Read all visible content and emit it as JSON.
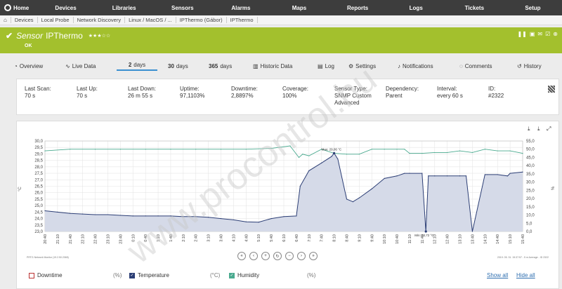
{
  "topnav": {
    "home": "Home",
    "items": [
      "Devices",
      "Libraries",
      "Sensors",
      "Alarms",
      "Maps",
      "Reports",
      "Logs",
      "Tickets",
      "Setup"
    ]
  },
  "breadcrumbs": [
    "Devices",
    "Local Probe",
    "Network Discovery",
    "Linux / MacOS / ...",
    "IPThermo (Gábor)",
    "IPThermo"
  ],
  "sensor": {
    "kind": "Sensor",
    "name": "IPThermo",
    "stars": "★★★☆☆",
    "status": "OK",
    "bar_color": "#a3c02d"
  },
  "tabs": [
    {
      "icon": "◔",
      "label": "Overview"
    },
    {
      "icon": "∿",
      "label": "Live Data"
    },
    {
      "num": "2",
      "label": "days",
      "active": true
    },
    {
      "num": "30",
      "label": "days"
    },
    {
      "num": "365",
      "label": "days"
    },
    {
      "icon": "▥",
      "label": "Historic Data"
    },
    {
      "icon": "▤",
      "label": "Log"
    },
    {
      "icon": "⚙",
      "label": "Settings"
    },
    {
      "icon": "🔔",
      "label": "Notifications"
    },
    {
      "icon": "◌",
      "label": "Comments"
    },
    {
      "icon": "↺",
      "label": "History"
    }
  ],
  "info": {
    "last_scan": {
      "label": "Last Scan:",
      "value": "70 s"
    },
    "last_up": {
      "label": "Last Up:",
      "value": "70 s"
    },
    "last_down": {
      "label": "Last Down:",
      "value": "26 m 55 s"
    },
    "uptime": {
      "label": "Uptime:",
      "value": "97,1103%"
    },
    "downtime": {
      "label": "Downtime:",
      "value": "2,8897%"
    },
    "coverage": {
      "label": "Coverage:",
      "value": "100%"
    },
    "sensor_type": {
      "label": "Sensor Type:",
      "value": "SNMP Custom",
      "value2": "Advanced"
    },
    "dependency": {
      "label": "Dependency:",
      "value": "Parent"
    },
    "interval": {
      "label": "Interval:",
      "value": "every 60 s"
    },
    "id": {
      "label": "ID:",
      "value": "#2322"
    }
  },
  "chart_data": {
    "type": "line",
    "title": "",
    "y_left": {
      "label": "°C",
      "range": [
        23.0,
        30.0
      ],
      "ticks": [
        "30,0",
        "29,5",
        "29,0",
        "28,5",
        "28,0",
        "27,5",
        "27,0",
        "26,5",
        "26,0",
        "25,5",
        "25,0",
        "24,5",
        "24,0",
        "23,5",
        "23,0"
      ]
    },
    "y_right": {
      "label": "%",
      "range": [
        0,
        55
      ],
      "ticks": [
        "55,0",
        "50,0",
        "45,0",
        "40,0",
        "35,0",
        "30,0",
        "25,0",
        "20,0",
        "15,0",
        "10,0",
        "5,0",
        "0,0"
      ]
    },
    "x_ticks": [
      "20:40",
      "21:10",
      "21:40",
      "22:10",
      "22:40",
      "23:10",
      "23:40",
      "0:10",
      "0:40",
      "1:10",
      "1:40",
      "2:10",
      "2:40",
      "3:10",
      "3:40",
      "4:10",
      "4:40",
      "5:10",
      "5:40",
      "6:10",
      "6:40",
      "7:10",
      "7:40",
      "8:10",
      "8:40",
      "9:10",
      "9:40",
      "10:10",
      "10:40",
      "11:10",
      "11:40",
      "12:10",
      "12:40",
      "13:10",
      "13:40",
      "14:10",
      "14:40",
      "15:10",
      "15:40"
    ],
    "annotations": {
      "max_label": "Max: 29,06 °C",
      "min_label": "Min: 23,72 °C"
    },
    "series": [
      {
        "name": "Temperature",
        "unit": "°C",
        "color": "#2c3e75",
        "x": [
          0,
          1,
          2,
          3,
          4,
          5,
          6,
          7,
          8,
          9,
          10,
          11,
          12,
          13,
          14,
          15,
          16,
          17,
          18,
          19,
          20,
          20.3,
          21,
          22,
          22.8,
          23,
          23.3,
          24,
          24.5,
          25,
          26,
          27,
          28,
          28.6,
          29,
          30,
          30.3,
          30.5,
          31,
          32,
          33,
          33.5,
          34,
          35,
          35.2,
          36,
          36.8,
          37,
          38
        ],
        "values": [
          24.6,
          24.5,
          24.4,
          24.35,
          24.3,
          24.3,
          24.25,
          24.2,
          24.2,
          24.2,
          24.2,
          24.15,
          24.15,
          24.1,
          24.0,
          23.9,
          23.75,
          23.72,
          24.0,
          24.15,
          24.2,
          26.5,
          27.7,
          28.3,
          28.8,
          29.06,
          28.6,
          25.5,
          25.3,
          25.6,
          26.3,
          27.1,
          27.3,
          27.5,
          27.5,
          27.5,
          23.0,
          27.3,
          27.3,
          27.3,
          27.3,
          27.3,
          23.0,
          27.4,
          27.4,
          27.4,
          27.3,
          27.5,
          27.6
        ]
      },
      {
        "name": "Humidity",
        "unit": "%",
        "color": "#4aaa8f",
        "x": [
          0,
          2,
          4,
          6,
          8,
          10,
          12,
          14,
          16,
          18,
          19.5,
          20.2,
          20.5,
          21,
          22,
          23,
          24,
          25,
          26,
          27,
          28,
          28.6,
          29,
          30,
          31,
          32,
          33,
          34,
          35,
          36,
          37,
          38
        ],
        "values": [
          49,
          50,
          50,
          50,
          50,
          50,
          50,
          50,
          50,
          50.5,
          52,
          45,
          47,
          46,
          50,
          47.5,
          47,
          47,
          50,
          50,
          50,
          50,
          47.5,
          47.5,
          48,
          48,
          49,
          48,
          50,
          49,
          49,
          47.5
        ]
      }
    ],
    "footer_left": "PRTG Network Monitor (19.2.50.2065)",
    "footer_right": "2019. 05. 31. 15:37:57 - 5 m Average - ID 2322",
    "legend": [
      {
        "name": "Downtime",
        "unit": "(%)",
        "checked": false
      },
      {
        "name": "Temperature",
        "unit": "(°C)",
        "checked": true
      },
      {
        "name": "Humidity",
        "unit": "(%)",
        "checked": true
      }
    ],
    "show_all": "Show all",
    "hide_all": "Hide all"
  },
  "watermark": "www.procontrol.hu"
}
